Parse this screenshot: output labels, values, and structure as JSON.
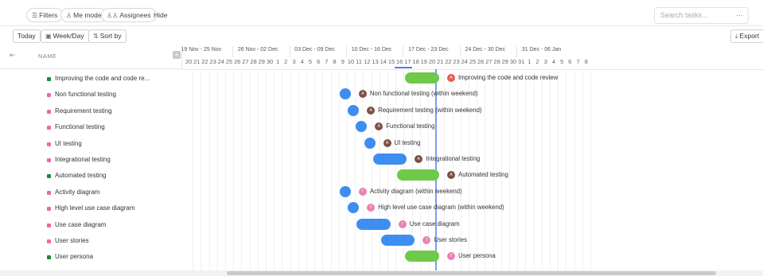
{
  "filters": {
    "filters_label": "Filters",
    "me_mode_label": "Me mode",
    "assignees_label": "Assignees",
    "hide_label": "Hide",
    "search_placeholder": "Search tasks...",
    "more_label": "···"
  },
  "toolbar": {
    "today_label": "Today",
    "view_label": "Week/Day",
    "sort_label": "Sort by",
    "export_label": "Export"
  },
  "list_header": {
    "name_label": "NAME"
  },
  "timeline": {
    "weeks": [
      "19 Nov - 25 Nov",
      "26 Nov - 02 Dec",
      "03 Dec - 09 Dec",
      "10 Dec - 16 Dec",
      "17 Dec - 23 Dec",
      "24 Dec - 30 Dec",
      "31 Dec - 06 Jan"
    ],
    "days": [
      "20",
      "21",
      "22",
      "23",
      "24",
      "25",
      "26",
      "27",
      "28",
      "29",
      "30",
      "1",
      "2",
      "3",
      "4",
      "5",
      "6",
      "7",
      "8",
      "9",
      "10",
      "11",
      "12",
      "13",
      "14",
      "15",
      "16",
      "17",
      "18",
      "19",
      "20",
      "21",
      "22",
      "23",
      "24",
      "25",
      "26",
      "27",
      "28",
      "29",
      "30",
      "31",
      "1",
      "2",
      "3",
      "4",
      "5",
      "6",
      "7",
      "8"
    ],
    "today_day": "16"
  },
  "tasks": [
    {
      "name": "Improving the code and code re...",
      "bar_label": "Improving the code and code review",
      "status_color": "#1e8a3c",
      "bar_color": "#6fc94a",
      "avatar": "A",
      "avatar_color": "#e35b5b",
      "start": "17 Dec",
      "end": "19 Dec",
      "kind": "bar"
    },
    {
      "name": "Non functional testing",
      "bar_label": "Non functional testing (within weekend)",
      "status_color": "#ec6aa0",
      "bar_color": "#3d8ef0",
      "avatar": "A",
      "avatar_color": "#7d4f46",
      "start": "9 Dec",
      "end": "9 Dec",
      "kind": "dot"
    },
    {
      "name": "Requirement testing",
      "bar_label": "Requirement testing (within weekend)",
      "status_color": "#ec6aa0",
      "bar_color": "#3d8ef0",
      "avatar": "A",
      "avatar_color": "#7d4f46",
      "start": "10 Dec",
      "end": "10 Dec",
      "kind": "dot"
    },
    {
      "name": "Functional testing",
      "bar_label": "Functional testing",
      "status_color": "#ec6aa0",
      "bar_color": "#3d8ef0",
      "avatar": "A",
      "avatar_color": "#7d4f46",
      "start": "11 Dec",
      "end": "11 Dec",
      "kind": "dot"
    },
    {
      "name": "UI testing",
      "bar_label": "UI testing",
      "status_color": "#ec6aa0",
      "bar_color": "#3d8ef0",
      "avatar": "A",
      "avatar_color": "#7d4f46",
      "start": "12 Dec",
      "end": "12 Dec",
      "kind": "dot"
    },
    {
      "name": "Integrational testing",
      "bar_label": "Integrational testing",
      "status_color": "#ec6aa0",
      "bar_color": "#3d8ef0",
      "avatar": "A",
      "avatar_color": "#7d4f46",
      "start": "13 Dec",
      "end": "15 Dec",
      "kind": "bar"
    },
    {
      "name": "Automated testing",
      "bar_label": "Automated testing",
      "status_color": "#1e8a3c",
      "bar_color": "#6fc94a",
      "avatar": "A",
      "avatar_color": "#7d4f46",
      "start": "16 Dec",
      "end": "19 Dec",
      "kind": "bar"
    },
    {
      "name": "Activity diagram",
      "bar_label": "Activity diagram (within weekend)",
      "status_color": "#ec6aa0",
      "bar_color": "#3d8ef0",
      "avatar": "T",
      "avatar_color": "#ec7fb5",
      "start": "9 Dec",
      "end": "9 Dec",
      "kind": "dot"
    },
    {
      "name": "High level use case diagram",
      "bar_label": "High level use case diagram (within weekend)",
      "status_color": "#ec6aa0",
      "bar_color": "#3d8ef0",
      "avatar": "T",
      "avatar_color": "#ec7fb5",
      "start": "10 Dec",
      "end": "10 Dec",
      "kind": "dot"
    },
    {
      "name": "Use case diagram",
      "bar_label": "Use case diagram",
      "status_color": "#ec6aa0",
      "bar_color": "#3d8ef0",
      "avatar": "T",
      "avatar_color": "#ec7fb5",
      "start": "11 Dec",
      "end": "13 Dec",
      "kind": "bar"
    },
    {
      "name": "User stories",
      "bar_label": "User stories",
      "status_color": "#ec6aa0",
      "bar_color": "#3d8ef0",
      "avatar": "T",
      "avatar_color": "#ec7fb5",
      "start": "14 Dec",
      "end": "16 Dec",
      "kind": "bar"
    },
    {
      "name": "User persona",
      "bar_label": "User persona",
      "status_color": "#1e8a3c",
      "bar_color": "#6fc94a",
      "avatar": "T",
      "avatar_color": "#ec7fb5",
      "start": "17 Dec",
      "end": "19 Dec",
      "kind": "bar"
    }
  ]
}
